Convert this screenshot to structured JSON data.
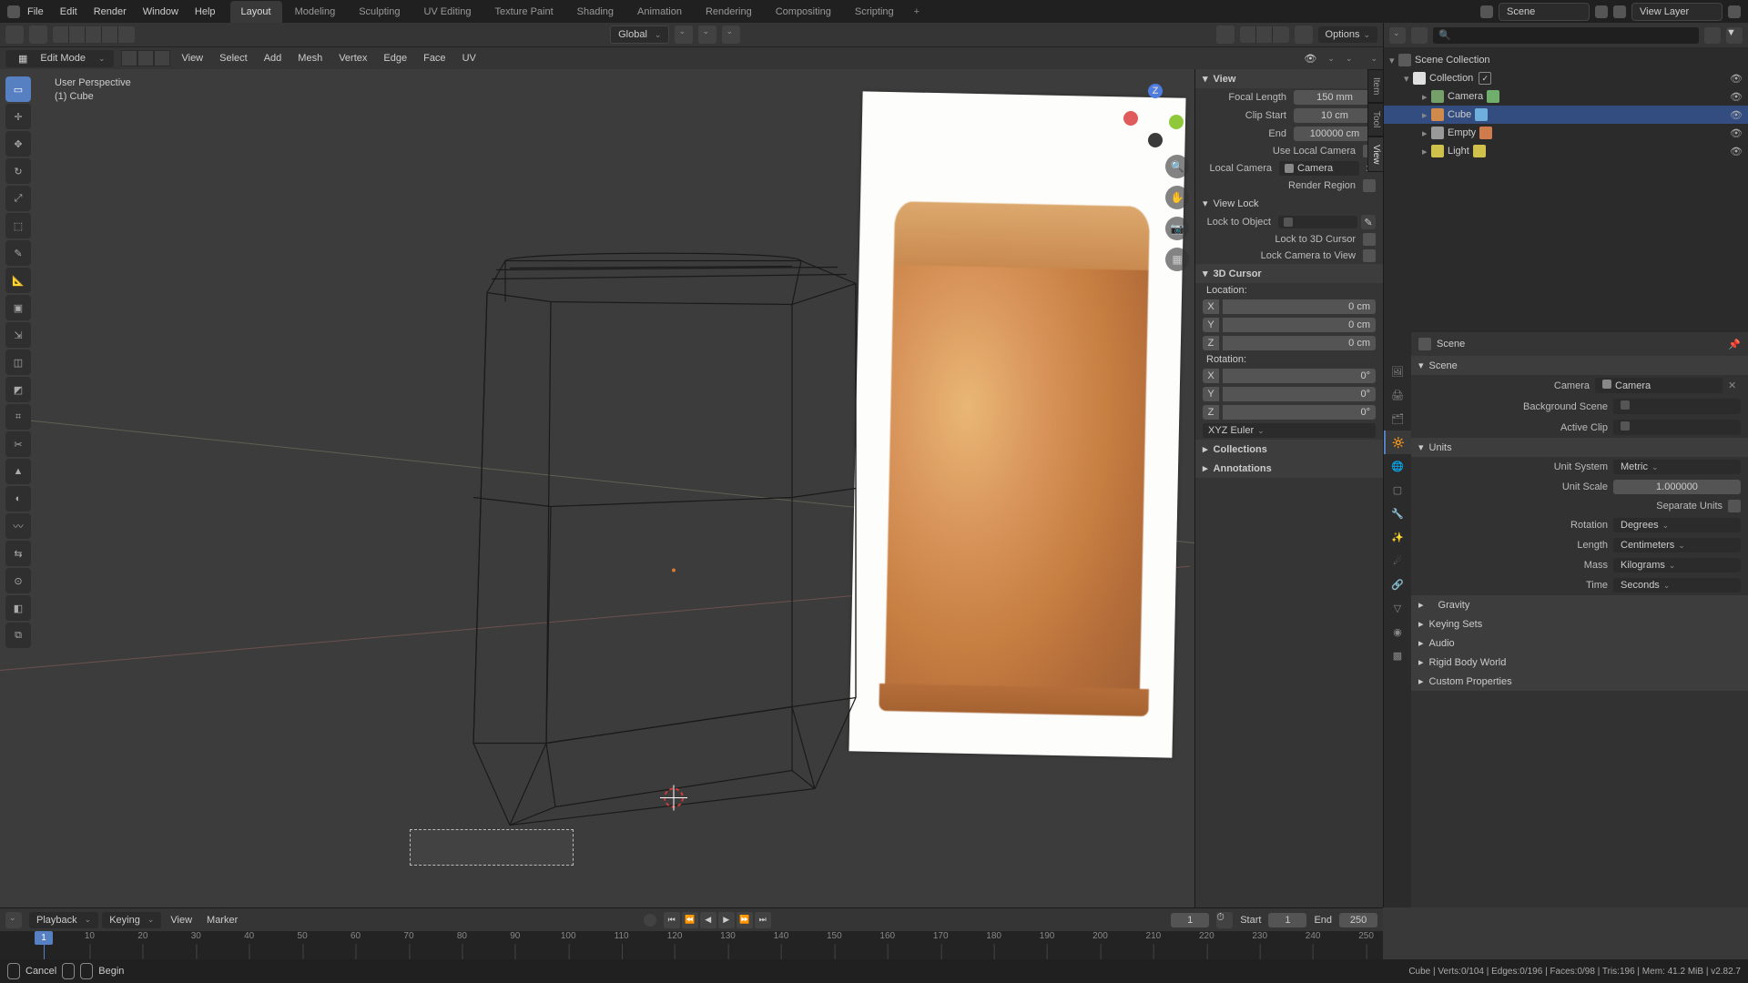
{
  "menu": [
    "File",
    "Edit",
    "Render",
    "Window",
    "Help"
  ],
  "workspaces": [
    "Layout",
    "Modeling",
    "Sculpting",
    "UV Editing",
    "Texture Paint",
    "Shading",
    "Animation",
    "Rendering",
    "Compositing",
    "Scripting"
  ],
  "active_workspace": "Layout",
  "scene": "Scene",
  "view_layer": "View Layer",
  "vpheader": {
    "orientation": "Global",
    "options": "Options"
  },
  "mode": "Edit Mode",
  "edit_menus": [
    "View",
    "Select",
    "Add",
    "Mesh",
    "Vertex",
    "Edge",
    "Face",
    "UV"
  ],
  "info": {
    "line1": "User Perspective",
    "line2": "(1) Cube"
  },
  "tools": [
    "select-box",
    "cursor",
    "move",
    "rotate",
    "scale",
    "transform",
    "annotate",
    "measure",
    "add-cube",
    "extrude",
    "inset",
    "bevel",
    "loop-cut",
    "knife",
    "poly-build",
    "spin",
    "smooth",
    "edge-slide",
    "shrink",
    "shear",
    "rip"
  ],
  "gizmo_axes": {
    "x": "X",
    "y": "Y",
    "z": "Z"
  },
  "npanel": {
    "tabs": [
      "Item",
      "Tool",
      "View"
    ],
    "active_tab": "View",
    "view_hdr": "View",
    "focal": {
      "label": "Focal Length",
      "value": "150 mm"
    },
    "clipstart": {
      "label": "Clip Start",
      "value": "10 cm"
    },
    "clipend": {
      "label": "End",
      "value": "100000 cm"
    },
    "use_local": {
      "label": "Use Local Camera"
    },
    "local_cam": {
      "label": "Local Camera",
      "value": "Camera"
    },
    "render_region": {
      "label": "Render Region"
    },
    "viewlock_hdr": "View Lock",
    "lock_obj": {
      "label": "Lock to Object"
    },
    "lock_cursor": {
      "label": "Lock to 3D Cursor"
    },
    "lock_cam": {
      "label": "Lock Camera to View"
    },
    "cursor_hdr": "3D Cursor",
    "location": "Location:",
    "rotation": "Rotation:",
    "xyz": {
      "x": "X",
      "y": "Y",
      "z": "Z"
    },
    "loc": {
      "x": "0 cm",
      "y": "0 cm",
      "z": "0 cm"
    },
    "rot": {
      "x": "0°",
      "y": "0°",
      "z": "0°"
    },
    "rotorder": "XYZ Euler",
    "collections_hdr": "Collections",
    "annotations_hdr": "Annotations"
  },
  "outliner": {
    "root": "Scene Collection",
    "coll": "Collection",
    "items": [
      {
        "name": "Camera",
        "type": "camera"
      },
      {
        "name": "Cube",
        "type": "mesh",
        "selected": true
      },
      {
        "name": "Empty",
        "type": "empty"
      },
      {
        "name": "Light",
        "type": "light"
      }
    ]
  },
  "props": {
    "crumb": "Scene",
    "scene_hdr": "Scene",
    "camera": {
      "label": "Camera",
      "value": "Camera"
    },
    "bgscene": {
      "label": "Background Scene"
    },
    "clip": {
      "label": "Active Clip"
    },
    "units_hdr": "Units",
    "unitsys": {
      "label": "Unit System",
      "value": "Metric"
    },
    "unitscale": {
      "label": "Unit Scale",
      "value": "1.000000"
    },
    "separate": {
      "label": "Separate Units"
    },
    "rotation": {
      "label": "Rotation",
      "value": "Degrees"
    },
    "length": {
      "label": "Length",
      "value": "Centimeters"
    },
    "mass": {
      "label": "Mass",
      "value": "Kilograms"
    },
    "time": {
      "label": "Time",
      "value": "Seconds"
    },
    "gravity_hdr": "Gravity",
    "keying_hdr": "Keying Sets",
    "audio_hdr": "Audio",
    "rigid_hdr": "Rigid Body World",
    "custom_hdr": "Custom Properties"
  },
  "timeline": {
    "menus": [
      "Playback",
      "Keying",
      "View",
      "Marker"
    ],
    "current": "1",
    "start_lbl": "Start",
    "start": "1",
    "end_lbl": "End",
    "end": "250",
    "ticks": [
      10,
      20,
      30,
      40,
      50,
      60,
      70,
      80,
      90,
      100,
      110,
      120,
      130,
      140,
      150,
      160,
      170,
      180,
      190,
      200,
      210,
      220,
      230,
      240,
      250
    ]
  },
  "status": {
    "left": [
      "Cancel",
      "Begin"
    ],
    "right": "Cube | Verts:0/104 | Edges:0/196 | Faces:0/98 | Tris:196 | Mem: 41.2 MiB | v2.82.7"
  }
}
